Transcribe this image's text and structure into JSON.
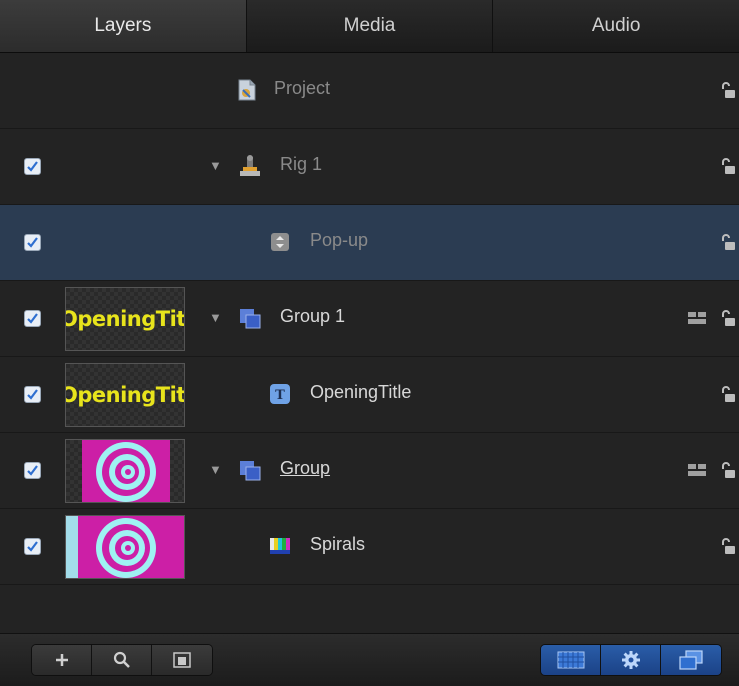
{
  "tabs": [
    {
      "label": "Layers",
      "active": true
    },
    {
      "label": "Media",
      "active": false
    },
    {
      "label": "Audio",
      "active": false
    }
  ],
  "rows": [
    {
      "name": "Project",
      "checked": false,
      "icon": "project-icon",
      "thumbnail": null,
      "expanded": null
    },
    {
      "name": "Rig 1",
      "checked": true,
      "icon": "rig-icon",
      "thumbnail": null,
      "expanded": true
    },
    {
      "name": "Pop-up",
      "checked": true,
      "icon": "popup-widget-icon",
      "thumbnail": null,
      "selected": true
    },
    {
      "name": "Group 1",
      "checked": true,
      "icon": "group-icon",
      "thumbnail": "OpeningTitle",
      "expanded": true
    },
    {
      "name": "OpeningTitle",
      "checked": true,
      "icon": "text-layer-icon",
      "thumbnail": "OpeningTitle"
    },
    {
      "name": "Group",
      "checked": true,
      "icon": "group-icon",
      "thumbnail": "spiral",
      "expanded": true
    },
    {
      "name": "Spirals",
      "checked": true,
      "icon": "generator-icon",
      "thumbnail": "spiral"
    }
  ],
  "thumb_text": "OpeningTitle",
  "bottom_left_buttons": [
    "add-icon",
    "search-icon",
    "thumbnail-view-icon"
  ],
  "bottom_right_buttons": [
    "transparency-icon",
    "gear-icon",
    "layers-view-icon"
  ],
  "colors": {
    "selection": "#2b3c52",
    "accent_blue": "#2a5da8",
    "thumb_text": "#e8e41c",
    "spiral_magenta": "#cc1fa6",
    "spiral_cyan": "#9ff2f2"
  }
}
